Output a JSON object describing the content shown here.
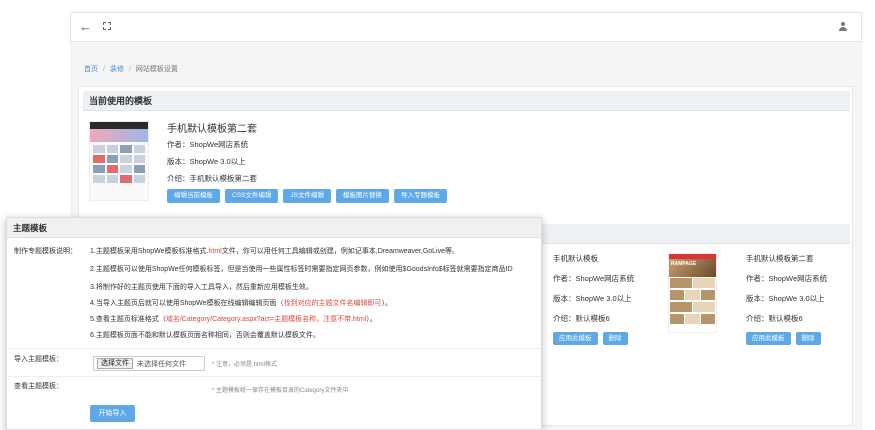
{
  "breadcrumb": {
    "home": "首页",
    "decor": "装修",
    "current": "网站模板设置"
  },
  "current_template": {
    "section_title": "当前使用的模板",
    "name": "手机默认模板第二套",
    "author": "作者：ShopWe网店系统",
    "version": "版本：ShopWe 3.0以上",
    "intro": "介绍：手机默认模板第二套",
    "buttons": [
      "编辑当前模板",
      "CSS文件编辑",
      "JS文件编辑",
      "模板图片替换",
      "导入专题模板"
    ]
  },
  "template_cards": [
    {
      "name": "手机默认模板",
      "author": "作者：ShopWe网店系统",
      "version": "版本：ShopWe 3.0以上",
      "intro": "介绍：默认模板6",
      "apply": "应用此模板",
      "delete": "删除"
    },
    {
      "name": "手机默认模板第二套",
      "author": "作者：ShopWe网店系统",
      "version": "版本：ShopWe 3.0以上",
      "intro": "介绍：默认模板6",
      "apply": "应用此模板",
      "delete": "删除"
    }
  ],
  "dialog": {
    "title": "主题模板",
    "instructions_label": "制作专题模板说明：",
    "lines": {
      "l1a": "1.主题模板采用ShopWe模板标准格式.",
      "l1b": "html",
      "l1c": "文件，你可以用任何工具编辑或创建，例如记事本,Dreamweaver,GoLive等。",
      "l2": "2.主题模板可以使用ShopWe任何模板标签，但是当使用一些属性标签时需要指定网页参数，例如使用$GoodsInfo$标签就需要指定商品ID",
      "l3": "3.将制作好的主题页使用下面的导入工具导入，然后重新应用模板生效。",
      "l4a": "4.当导入主题页后就可以使用ShopWe模板在线编辑编辑页面（",
      "l4b": "找到对应的主题文件名编辑即可",
      "l4c": "）。",
      "l5a": "5.查看主题页标准格式（",
      "l5b": "域名/Category/Category.aspx?act=主题模板名称，注意不带.html",
      "l5c": "）。",
      "l6": "6.主题模板页面不能和默认模板页面名称相同，否则会覆盖默认模板文件。"
    },
    "import_label": "导入主题模板：",
    "file_button": "选择文件",
    "file_status": "未选择任何文件",
    "import_note": "* 注意，必须是.html格式",
    "view_label": "查看主题模板：",
    "view_note": "* 主题模板统一保存在模板目录的Category文件夹中",
    "submit": "开始导入"
  },
  "icons": {
    "back": "arrow-left-icon",
    "expand": "fullscreen-icon",
    "user": "user-icon"
  },
  "colors": {
    "primary": "#5fa8e8",
    "link": "#4a90c8",
    "warning": "#e0463c"
  }
}
